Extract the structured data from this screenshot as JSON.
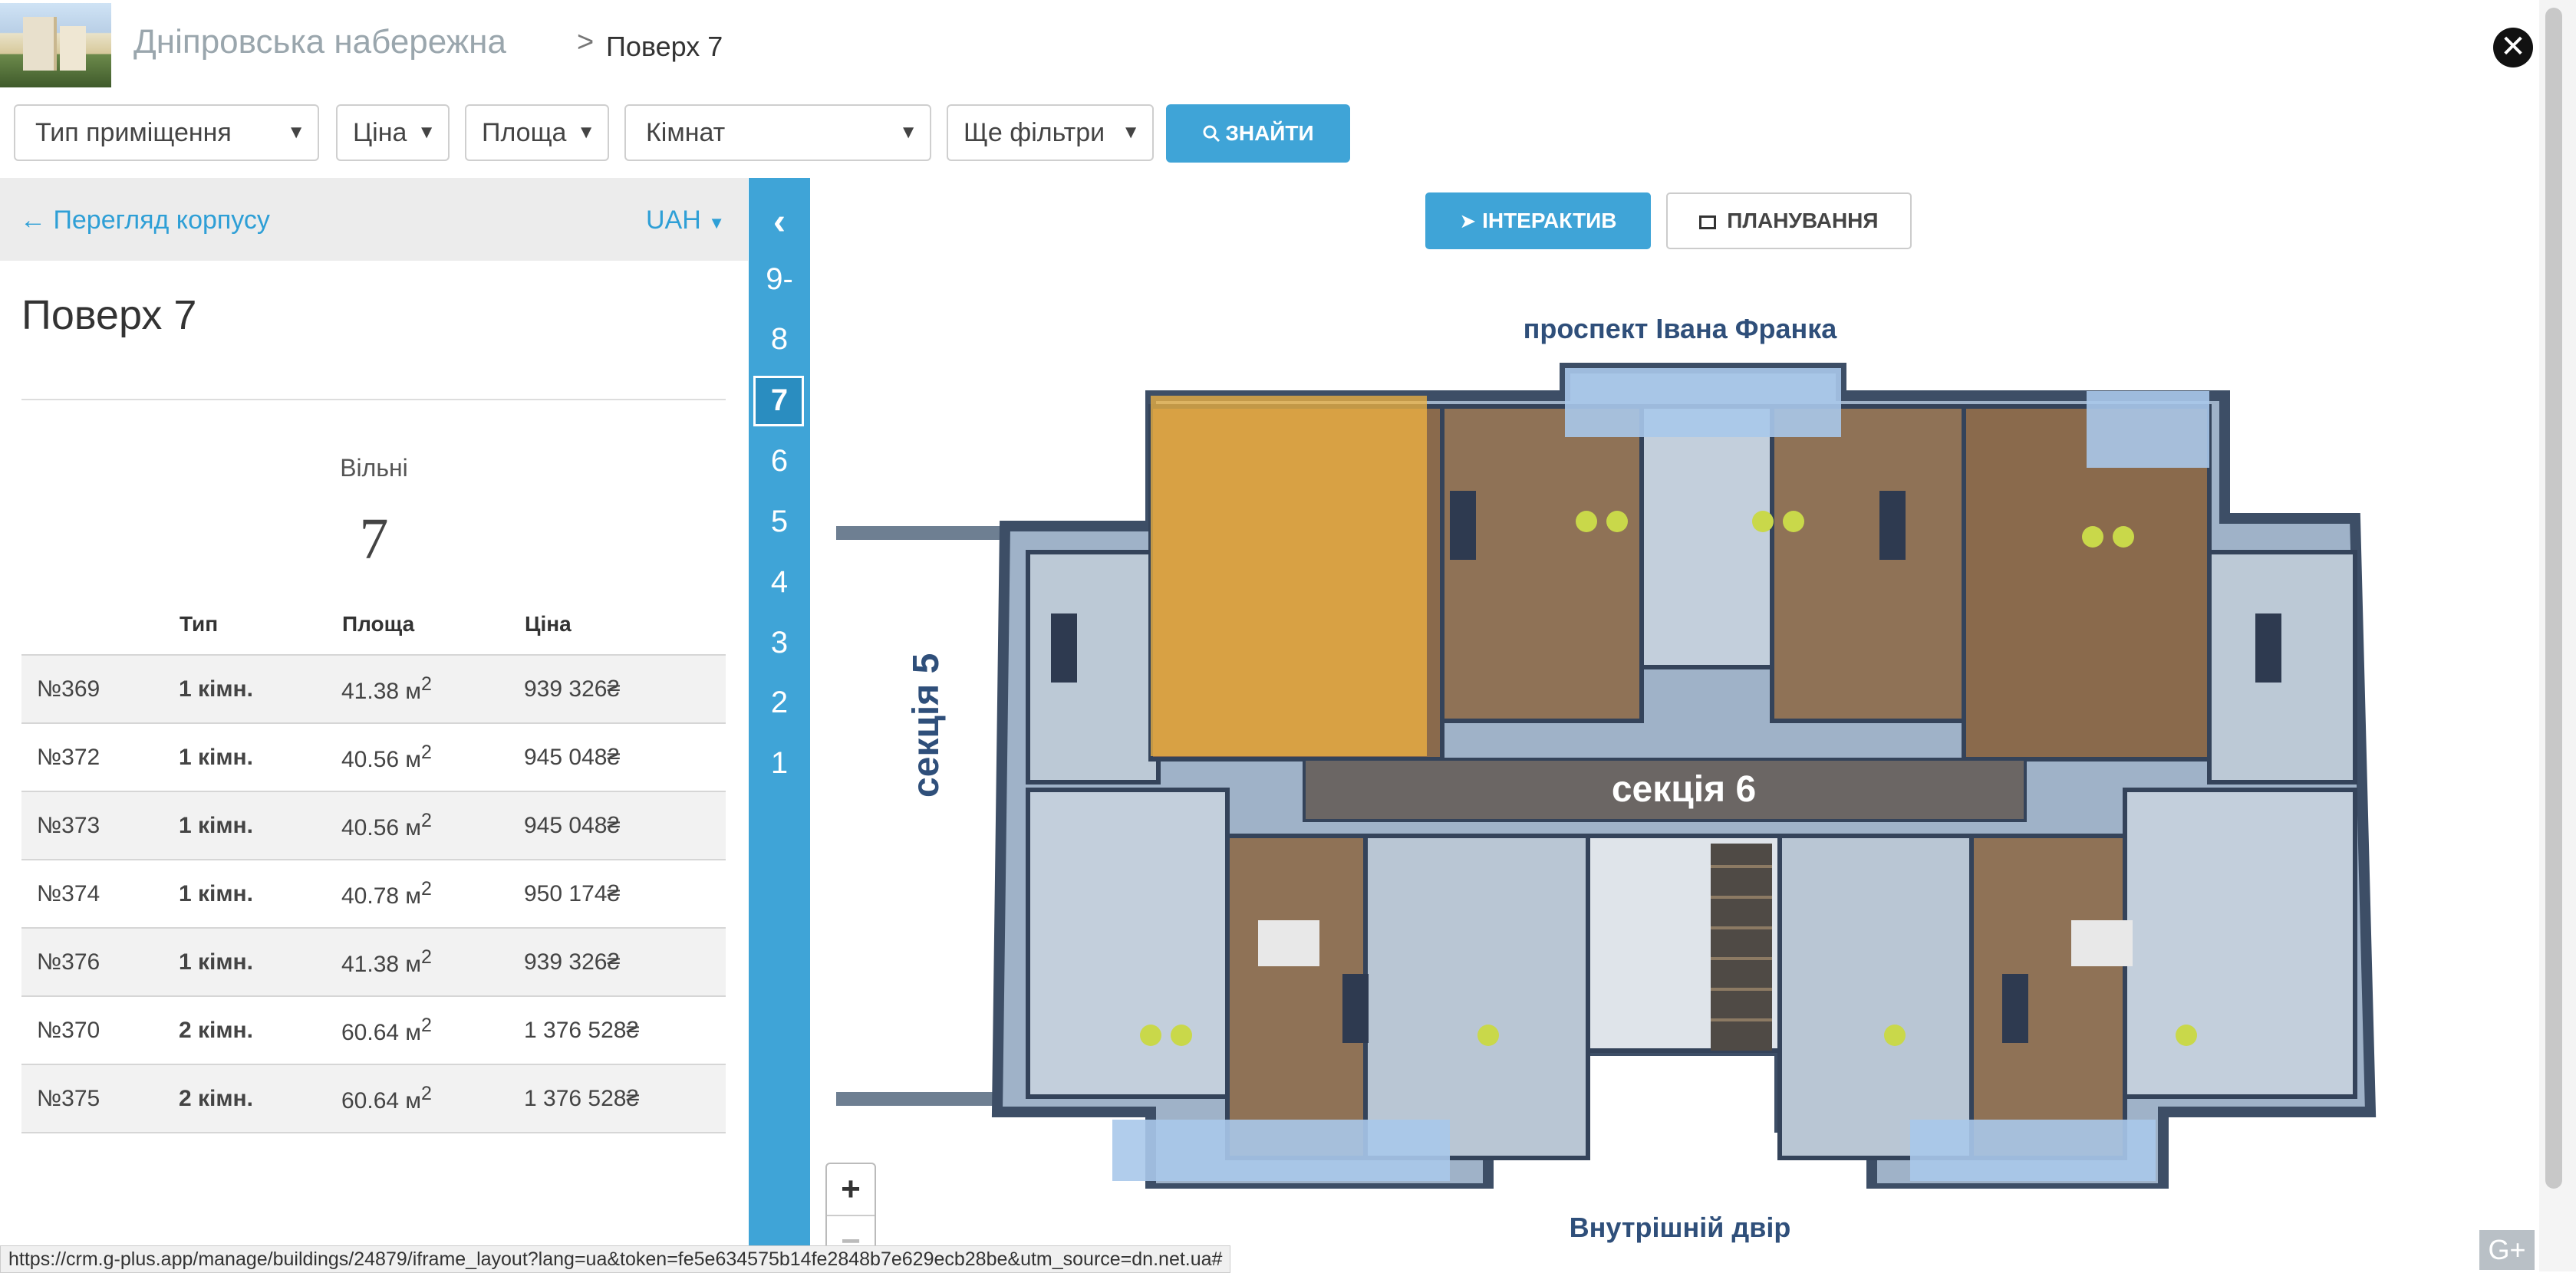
{
  "header": {
    "title": "Дніпровська набережна",
    "separator": ">",
    "crumb": "Поверх 7",
    "close": "✕"
  },
  "filters": {
    "type": "Тип приміщення",
    "price": "Ціна",
    "area": "Площа",
    "rooms": "Кімнат",
    "more": "Ще фільтри",
    "find": "ЗНАЙТИ"
  },
  "left_panel": {
    "back": "Перегляд корпусу",
    "currency": "UAH",
    "floor_title": "Поверх 7",
    "free_label": "Вільні",
    "free_count": "7",
    "columns": [
      "Тип",
      "Площа",
      "Ціна"
    ],
    "area_unit": "м",
    "area_exp": "2",
    "rows": [
      {
        "num": "№369",
        "type": "1 кімн.",
        "area": "41.38",
        "price": "939 326₴"
      },
      {
        "num": "№372",
        "type": "1 кімн.",
        "area": "40.56",
        "price": "945 048₴"
      },
      {
        "num": "№373",
        "type": "1 кімн.",
        "area": "40.56",
        "price": "945 048₴"
      },
      {
        "num": "№374",
        "type": "1 кімн.",
        "area": "40.78",
        "price": "950 174₴"
      },
      {
        "num": "№376",
        "type": "1 кімн.",
        "area": "41.38",
        "price": "939 326₴"
      },
      {
        "num": "№370",
        "type": "2 кімн.",
        "area": "60.64",
        "price": "1 376 528₴"
      },
      {
        "num": "№375",
        "type": "2 кімн.",
        "area": "60.64",
        "price": "1 376 528₴"
      }
    ]
  },
  "floors": {
    "toggle": "‹",
    "items": [
      "9-",
      "8",
      "7",
      "6",
      "5",
      "4",
      "3",
      "2",
      "1"
    ],
    "active": "7"
  },
  "plan": {
    "tab_interactive": "ІНТЕРАКТИВ",
    "tab_layout": "ПЛАНУВАННЯ",
    "street": "проспект Івана Франка",
    "section5": "секція 5",
    "section6": "секція 6",
    "yard": "Внутрішній двір",
    "zoom_in": "+",
    "zoom_out": "−"
  },
  "status_url": "https://crm.g-plus.app/manage/buildings/24879/iframe_layout?lang=ua&token=fe5e634575b14fe2848b7e629ecb28be&utm_source=dn.net.ua#",
  "badge": "G+",
  "colors": {
    "accent": "#3fa4d7",
    "plan_text": "#2f4f7a",
    "highlight": "#f2b441"
  }
}
